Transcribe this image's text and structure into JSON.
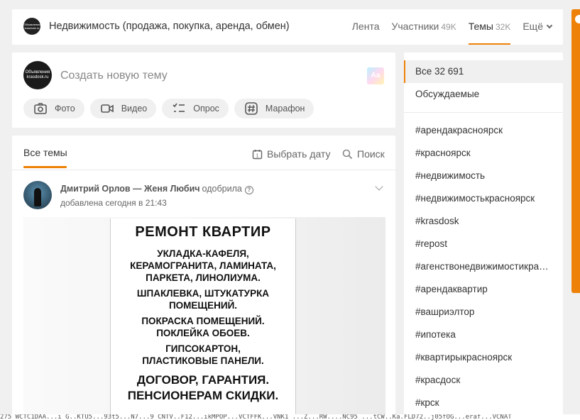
{
  "header": {
    "logo_text": "Объявления krasdosk.ru",
    "group_title": "Недвижимость (продажа, покупка, аренда, обмен)",
    "nav": [
      {
        "label": "Лента",
        "count": ""
      },
      {
        "label": "Участники",
        "count": "49K"
      },
      {
        "label": "Темы",
        "count": "32K"
      },
      {
        "label": "Ещё",
        "count": ""
      }
    ]
  },
  "compose": {
    "avatar_text": "Объявления krasdosk.ru",
    "placeholder": "Создать новую тему",
    "color_button": "Aa",
    "actions": [
      {
        "label": "Фото",
        "icon": "camera-icon"
      },
      {
        "label": "Видео",
        "icon": "video-icon"
      },
      {
        "label": "Опрос",
        "icon": "poll-icon"
      },
      {
        "label": "Марафон",
        "icon": "hashtag-icon"
      }
    ]
  },
  "feed": {
    "tab_all": "Все темы",
    "pick_date": "Выбрать дату",
    "search": "Поиск",
    "post": {
      "author": "Дмитрий Орлов — Женя Любич",
      "verb": "одобрила",
      "added": "добавлена сегодня в 21:43",
      "ad_lines": [
        "РЕМОНТ КВАРТИР",
        "УКЛАДКА-КАФЕЛЯ,",
        "КЕРАМОГРАНИТА, ЛАМИНАТА,",
        "ПАРКЕТА, ЛИНОЛИУМА.",
        "ШПАКЛЕВКА, ШТУКАТУРКА",
        "ПОМЕЩЕНИЙ.",
        "ПОКРАСКА ПОМЕЩЕНИЙ.",
        "ПОКЛЕЙКА ОБОЕВ.",
        "ГИПСОКАРТОН,",
        "ПЛАСТИКОВЫЕ ПАНЕЛИ.",
        "ДОГОВОР, ГАРАНТИЯ.",
        "ПЕНСИОНЕРАМ СКИДКИ."
      ]
    }
  },
  "sidebar": {
    "all_label": "Все 32 691",
    "discussed_label": "Обсуждаемые",
    "tags": [
      "#арендакрасноярск",
      "#красноярск",
      "#недвижимость",
      "#недвижимостькрасноярск",
      "#krasdosk",
      "#repost",
      "#агенствонедвижимостикрасноярск",
      "#арендаквартир",
      "#вашриэлтор",
      "#ипотека",
      "#квартирыкрасноярск",
      "#красдоск",
      "#крск"
    ]
  },
  "status_line": "275 WCTC1DAA...i G..KTU5...93t5...N7...9 CNTV..F12...ikMPOP...VCTFFK...VNK1 ...Z...RW....NC95 ...tCW..Ka.FLD72..j05fOG...eraf...VCNAT"
}
